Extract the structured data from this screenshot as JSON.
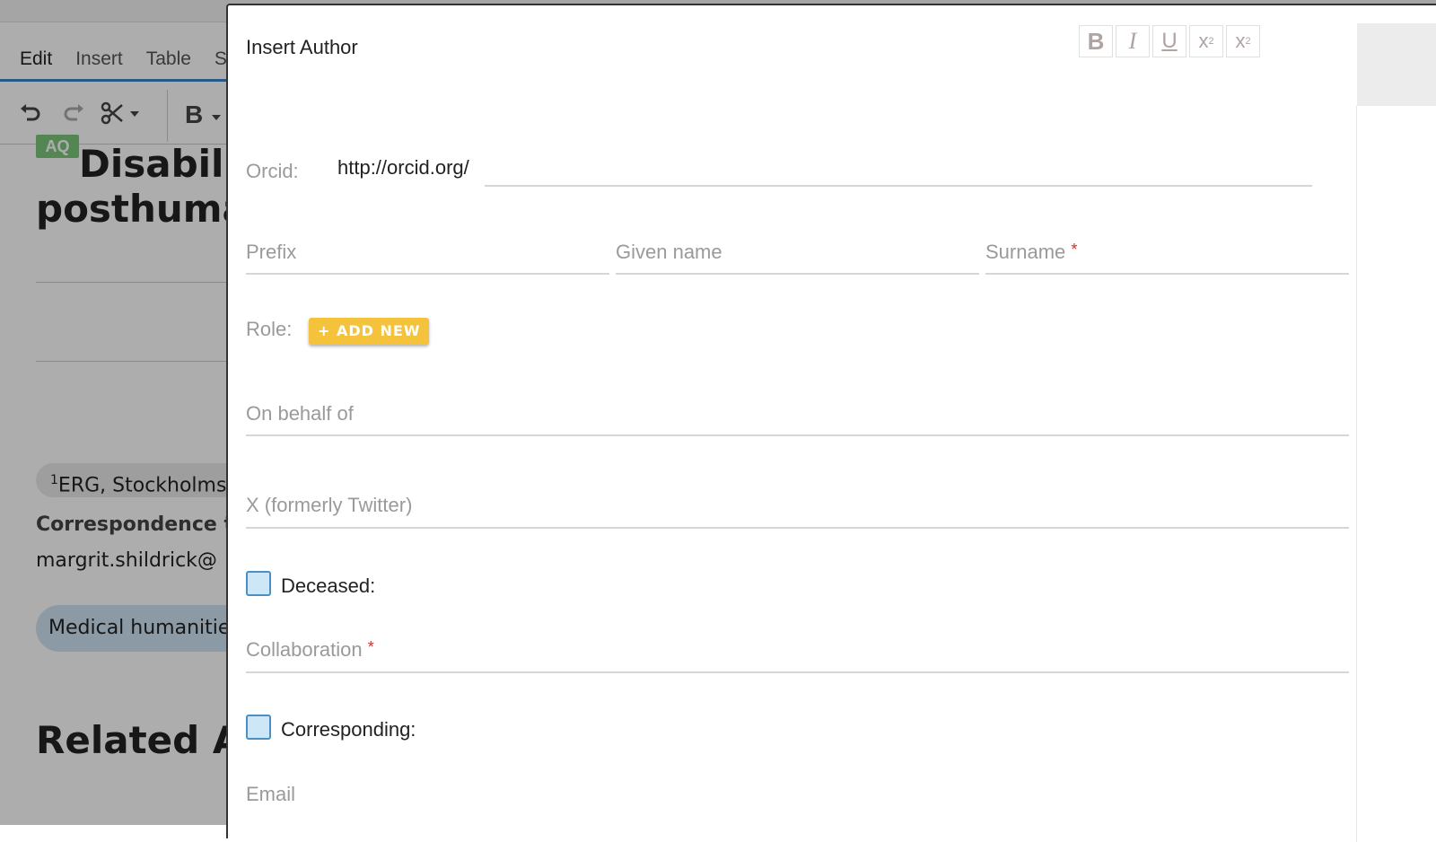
{
  "background": {
    "menu": [
      "Edit",
      "Insert",
      "Table",
      "S"
    ],
    "toolbar": {
      "undo_icon": "undo-icon",
      "redo_icon": "redo-icon",
      "cut_icon": "scissors-icon",
      "bold_label": "B"
    },
    "badge": "AQ",
    "title_line1": "Disabilit",
    "title_line2": "posthumar",
    "affiliation_sup": "1",
    "affiliation": "ERG, Stockholms",
    "correspondence": "Correspondence t",
    "email": "margrit.shildrick@",
    "tag": "Medical humanitie",
    "related": "Related Ar"
  },
  "dialog": {
    "title": "Insert Author",
    "format_buttons": [
      {
        "icon": "bold-icon",
        "glyph": "B"
      },
      {
        "icon": "italic-icon",
        "glyph": "I"
      },
      {
        "icon": "underline-icon",
        "glyph": "U"
      },
      {
        "icon": "superscript-icon",
        "glyph": "x²"
      },
      {
        "icon": "subscript-icon",
        "glyph": "x₂"
      }
    ],
    "orcid": {
      "label": "Orcid:",
      "prefix": "http://orcid.org/",
      "value": ""
    },
    "prefix": {
      "label": "Prefix"
    },
    "given_name": {
      "label": "Given name"
    },
    "surname": {
      "label": "Surname",
      "required": "*"
    },
    "role": {
      "label": "Role:",
      "add_new": "+ ADD NEW"
    },
    "on_behalf_of": {
      "label": "On behalf of"
    },
    "twitter": {
      "label": "X (formerly Twitter)"
    },
    "deceased": {
      "label": "Deceased:",
      "checked": false
    },
    "collaboration": {
      "label": "Collaboration",
      "required": "*"
    },
    "corresponding": {
      "label": "Corresponding:",
      "checked": false
    },
    "email": {
      "label": "Email"
    }
  }
}
